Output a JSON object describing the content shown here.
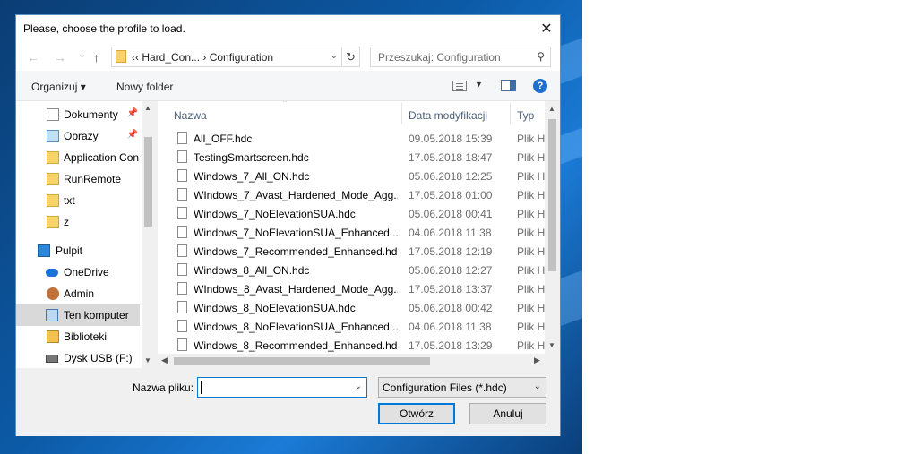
{
  "dialog": {
    "title": "Please, choose the profile to load.",
    "close_glyph": "✕"
  },
  "nav": {
    "back_glyph": "←",
    "forward_glyph": "→",
    "recent_glyph": "⌄",
    "up_glyph": "↑",
    "address": "‹‹   Hard_Con...  ›  Configuration",
    "refresh_glyph": "↻",
    "search_placeholder": "Przeszukaj: Configuration",
    "search_glyph": "⚲"
  },
  "toolbar": {
    "organize_label": "Organizuj ▾",
    "new_folder_label": "Nowy folder",
    "view_drop_glyph": "▼",
    "help_glyph": "?"
  },
  "sidebar": {
    "items": [
      {
        "label": "Dokumenty",
        "icon": "documents-icon",
        "pinned": "📌"
      },
      {
        "label": "Obrazy",
        "icon": "pictures-icon",
        "pinned": "📌"
      },
      {
        "label": "Application Con",
        "icon": "folder-icon"
      },
      {
        "label": "RunRemote",
        "icon": "folder-icon"
      },
      {
        "label": "txt",
        "icon": "folder-icon"
      },
      {
        "label": "z",
        "icon": "folder-icon"
      },
      {
        "label": "Pulpit",
        "icon": "desktop-icon"
      },
      {
        "label": "OneDrive",
        "icon": "onedrive-icon"
      },
      {
        "label": "Admin",
        "icon": "user-icon"
      },
      {
        "label": "Ten komputer",
        "icon": "computer-icon",
        "selected": true
      },
      {
        "label": "Biblioteki",
        "icon": "libraries-icon"
      },
      {
        "label": "Dysk USB (F:)",
        "icon": "usb-drive-icon"
      }
    ]
  },
  "columns": {
    "name": "Nazwa",
    "date": "Data modyfikacji",
    "type": "Typ"
  },
  "files": [
    {
      "name": "All_OFF.hdc",
      "date": "09.05.2018 15:39",
      "type": "Plik HDC"
    },
    {
      "name": "TestingSmartscreen.hdc",
      "date": "17.05.2018 18:47",
      "type": "Plik HDC"
    },
    {
      "name": "Windows_7_All_ON.hdc",
      "date": "05.06.2018 12:25",
      "type": "Plik HDC"
    },
    {
      "name": "WIndows_7_Avast_Hardened_Mode_Agg...",
      "date": "17.05.2018 01:00",
      "type": "Plik HDC"
    },
    {
      "name": "Windows_7_NoElevationSUA.hdc",
      "date": "05.06.2018 00:41",
      "type": "Plik HDC"
    },
    {
      "name": "Windows_7_NoElevationSUA_Enhanced....",
      "date": "04.06.2018 11:38",
      "type": "Plik HDC"
    },
    {
      "name": "Windows_7_Recommended_Enhanced.hdc",
      "date": "17.05.2018 12:19",
      "type": "Plik HDC"
    },
    {
      "name": "Windows_8_All_ON.hdc",
      "date": "05.06.2018 12:27",
      "type": "Plik HDC"
    },
    {
      "name": "WIndows_8_Avast_Hardened_Mode_Agg...",
      "date": "17.05.2018 13:37",
      "type": "Plik HDC"
    },
    {
      "name": "Windows_8_NoElevationSUA.hdc",
      "date": "05.06.2018 00:42",
      "type": "Plik HDC"
    },
    {
      "name": "Windows_8_NoElevationSUA_Enhanced....",
      "date": "04.06.2018 11:38",
      "type": "Plik HDC"
    },
    {
      "name": "Windows_8_Recommended_Enhanced.hdc",
      "date": "17.05.2018 13:29",
      "type": "Plik HDC"
    }
  ],
  "bottom": {
    "filename_label": "Nazwa pliku:",
    "filename_value": "",
    "filter_value": "Configuration Files (*.hdc)",
    "open_label": "Otwórz",
    "cancel_label": "Anuluj",
    "dropdown_glyph": "⌄"
  },
  "scroll": {
    "up_glyph": "▲",
    "down_glyph": "▼",
    "left_glyph": "◀",
    "right_glyph": "▶"
  }
}
